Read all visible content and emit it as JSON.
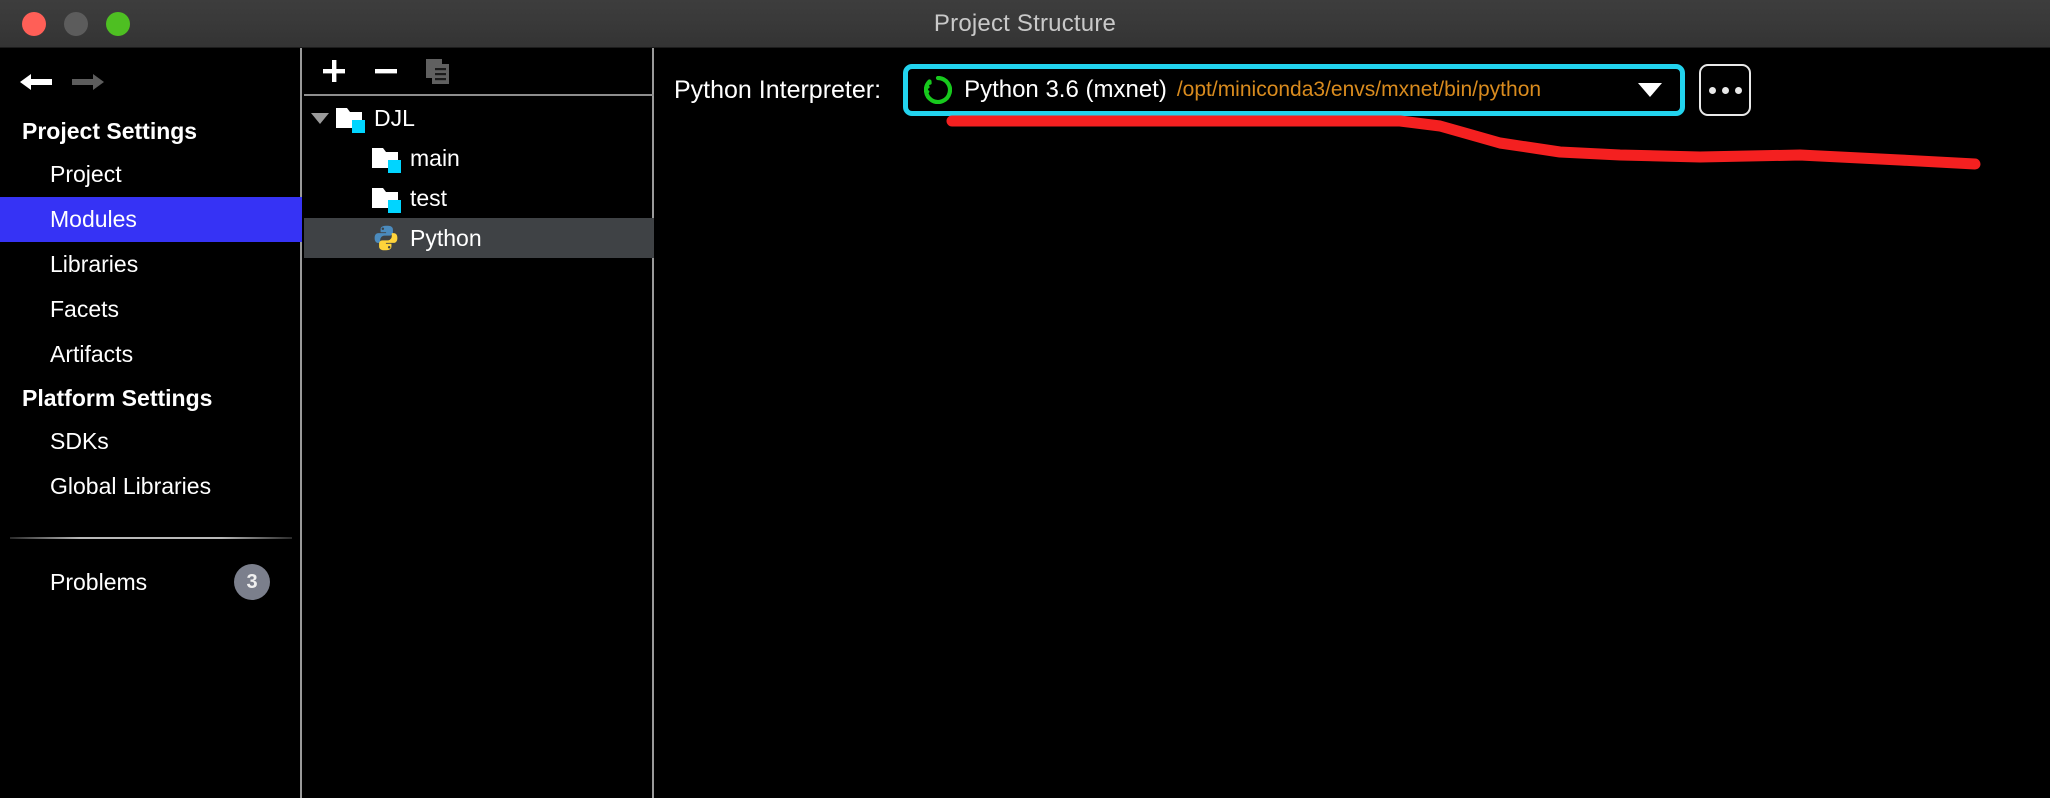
{
  "window": {
    "title": "Project Structure",
    "traffic_lights": [
      "close-button",
      "minimize-button",
      "zoom-button"
    ]
  },
  "nav": {
    "back_icon": "arrow-left-icon",
    "forward_icon": "arrow-right-icon"
  },
  "sidebar": {
    "groups": [
      {
        "label": "Project Settings",
        "items": [
          {
            "label": "Project",
            "selected": false
          },
          {
            "label": "Modules",
            "selected": true
          },
          {
            "label": "Libraries",
            "selected": false
          },
          {
            "label": "Facets",
            "selected": false
          },
          {
            "label": "Artifacts",
            "selected": false
          }
        ]
      },
      {
        "label": "Platform Settings",
        "items": [
          {
            "label": "SDKs",
            "selected": false
          },
          {
            "label": "Global Libraries",
            "selected": false
          }
        ]
      }
    ],
    "problems": {
      "label": "Problems",
      "count": "3"
    }
  },
  "tree_panel": {
    "toolbar": [
      {
        "name": "add-button",
        "icon": "plus-icon",
        "label": "+"
      },
      {
        "name": "remove-button",
        "icon": "minus-icon",
        "label": "−"
      },
      {
        "name": "copy-button",
        "icon": "copy-icon",
        "label": ""
      }
    ],
    "rows": [
      {
        "label": "DJL",
        "icon": "folder-module-icon",
        "depth": 0,
        "expanded": true,
        "selected": false,
        "twisty": "chevron-down-icon"
      },
      {
        "label": "main",
        "icon": "folder-source-icon",
        "depth": 1,
        "expanded": false,
        "selected": false,
        "twisty": ""
      },
      {
        "label": "test",
        "icon": "folder-test-icon",
        "depth": 1,
        "expanded": false,
        "selected": false,
        "twisty": ""
      },
      {
        "label": "Python",
        "icon": "python-icon",
        "depth": 1,
        "expanded": false,
        "selected": true,
        "twisty": ""
      }
    ]
  },
  "main": {
    "interpreter_label": "Python Interpreter:",
    "interpreter_icon": "python-env-spinner-icon",
    "interpreter_name": "Python 3.6 (mxnet)",
    "interpreter_path": "/opt/miniconda3/envs/mxnet/bin/python",
    "dropdown_icon": "chevron-down-icon",
    "more_button_label": "...",
    "more_button_icon": "ellipsis-icon"
  },
  "colors": {
    "selection_blue": "#3633f5",
    "tree_selection": "#3f4245",
    "highlight_cyan": "#22d3ee",
    "annotation_red": "#f42020",
    "path_orange": "#d98b1e",
    "titlebar": "#393939",
    "background": "#000000",
    "badge_gray": "#7b7f8c"
  },
  "annotation": {
    "highlight_shape": "rounded-rect-cyan-around-interpreter-combo",
    "underline_shape": "red-freehand-underline"
  }
}
